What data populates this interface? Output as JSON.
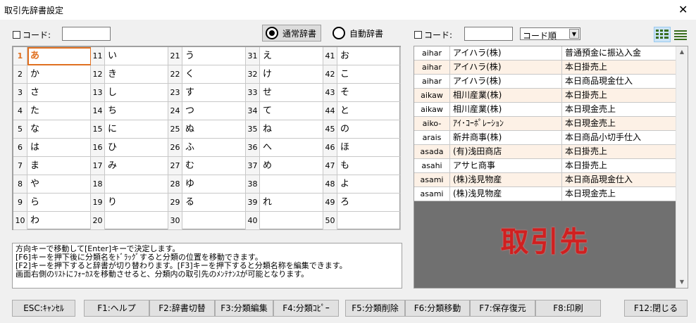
{
  "window": {
    "title": "取引先辞書設定",
    "close_glyph": "✕"
  },
  "left_code_label": "コード:",
  "left_code_value": "",
  "radios": [
    {
      "label": "通常辞書",
      "checked": true
    },
    {
      "label": "自動辞書",
      "checked": false
    }
  ],
  "right_code_label": "コード:",
  "right_code_value": "",
  "sort_select": "コード順",
  "view_icons": [
    "grid-view-icon",
    "list-view-icon"
  ],
  "grid_cells": [
    [
      "1",
      "あ"
    ],
    [
      "11",
      "い"
    ],
    [
      "21",
      "う"
    ],
    [
      "31",
      "え"
    ],
    [
      "41",
      "お"
    ],
    [
      "2",
      "か"
    ],
    [
      "12",
      "き"
    ],
    [
      "22",
      "く"
    ],
    [
      "32",
      "け"
    ],
    [
      "42",
      "こ"
    ],
    [
      "3",
      "さ"
    ],
    [
      "13",
      "し"
    ],
    [
      "23",
      "す"
    ],
    [
      "33",
      "せ"
    ],
    [
      "43",
      "そ"
    ],
    [
      "4",
      "た"
    ],
    [
      "14",
      "ち"
    ],
    [
      "24",
      "つ"
    ],
    [
      "34",
      "て"
    ],
    [
      "44",
      "と"
    ],
    [
      "5",
      "な"
    ],
    [
      "15",
      "に"
    ],
    [
      "25",
      "ぬ"
    ],
    [
      "35",
      "ね"
    ],
    [
      "45",
      "の"
    ],
    [
      "6",
      "は"
    ],
    [
      "16",
      "ひ"
    ],
    [
      "26",
      "ふ"
    ],
    [
      "36",
      "へ"
    ],
    [
      "46",
      "ほ"
    ],
    [
      "7",
      "ま"
    ],
    [
      "17",
      "み"
    ],
    [
      "27",
      "む"
    ],
    [
      "37",
      "め"
    ],
    [
      "47",
      "も"
    ],
    [
      "8",
      "や"
    ],
    [
      "18",
      ""
    ],
    [
      "28",
      "ゆ"
    ],
    [
      "38",
      ""
    ],
    [
      "48",
      "よ"
    ],
    [
      "9",
      "ら"
    ],
    [
      "19",
      "り"
    ],
    [
      "29",
      "る"
    ],
    [
      "39",
      "れ"
    ],
    [
      "49",
      "ろ"
    ],
    [
      "10",
      "わ"
    ],
    [
      "20",
      ""
    ],
    [
      "30",
      ""
    ],
    [
      "40",
      ""
    ],
    [
      "50",
      ""
    ]
  ],
  "selected_cell": "1",
  "client_rows": [
    [
      "aihar",
      "アイハラ(株)",
      "普通預金に振込入金"
    ],
    [
      "aihar",
      "アイハラ(株)",
      "本日掛売上"
    ],
    [
      "aihar",
      "アイハラ(株)",
      "本日商品現金仕入"
    ],
    [
      "aikaw",
      "相川産業(株)",
      "本日掛売上"
    ],
    [
      "aikaw",
      "相川産業(株)",
      "本日現金売上"
    ],
    [
      "aiko-",
      "ｱｲ･ｺｰﾎﾟﾚｰｼｮﾝ",
      "本日現金売上"
    ],
    [
      "arais",
      "新井商事(株)",
      "本日商品小切手仕入"
    ],
    [
      "asada",
      "(有)浅田商店",
      "本日掛売上"
    ],
    [
      "asahi",
      "アサヒ商事",
      "本日掛売上"
    ],
    [
      "asami",
      "(株)浅見物産",
      "本日商品現金仕入"
    ],
    [
      "asami",
      "(株)浅見物産",
      "本日現金売上"
    ]
  ],
  "overlay_text": "取引先",
  "help_lines": [
    "方向キーで移動して[Enter]キーで決定します。",
    "[F6]キーを押下後に分類名をﾄﾞﾗｯｸﾞすると分類の位置を移動できます。",
    "[F2]キーを押下すると辞書が切り替わります。[F3]キーを押下すると分類名称を編集できます。",
    "画面右側のﾘｽﾄにﾌｫｰｶｽを移動させると、分類内の取引先のﾒﾝﾃﾅﾝｽが可能となります。"
  ],
  "fkeys": {
    "esc": "ESC:ｷｬﾝｾﾙ",
    "f1": "F1:ヘルプ",
    "f2": "F2:辞書切替",
    "f3": "F3:分類編集",
    "f4": "F4:分類ｺﾋﾟｰ",
    "f5": "F5:分類削除",
    "f6": "F6:分類移動",
    "f7": "F7:保存復元",
    "f8": "F8:印刷",
    "f12": "F12:閉じる"
  }
}
